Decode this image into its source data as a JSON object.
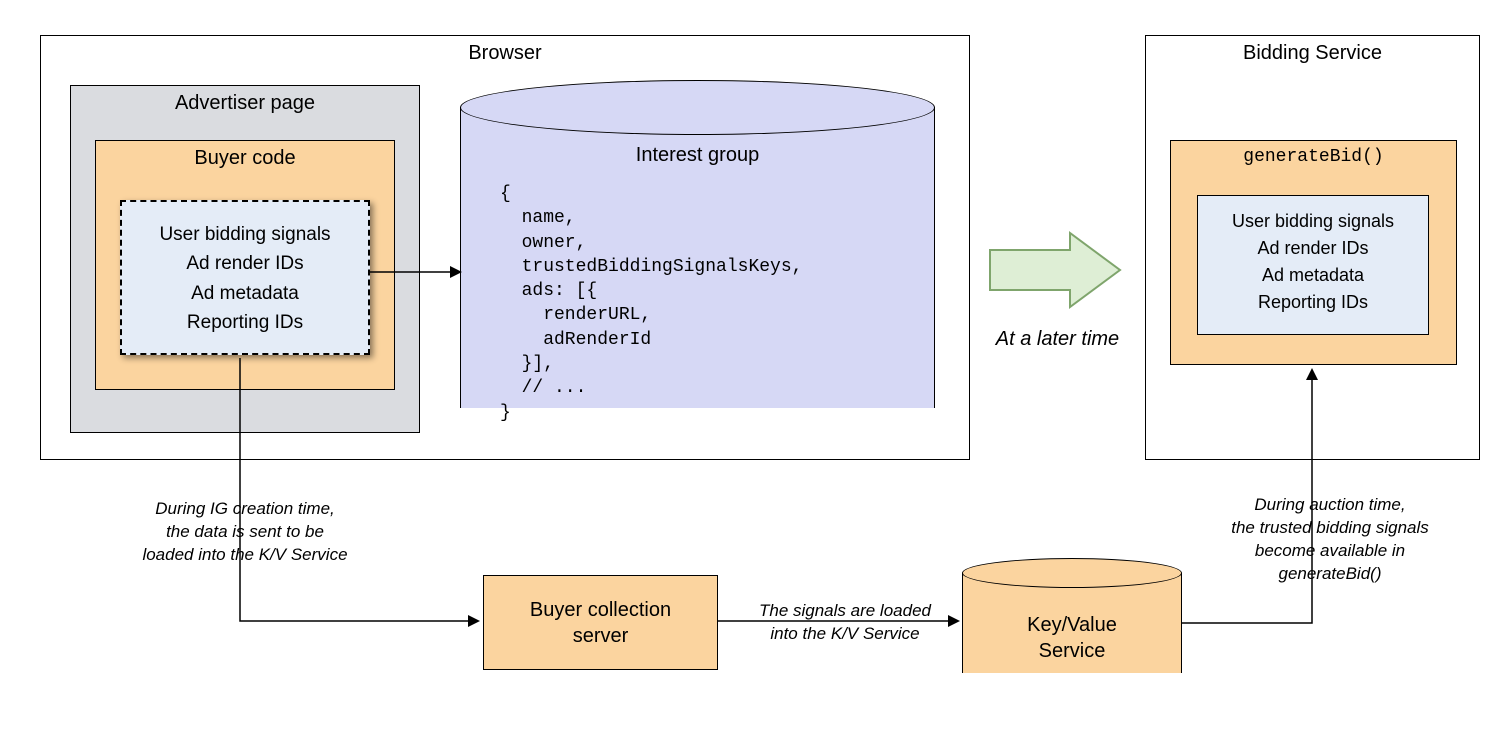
{
  "browser": {
    "title": "Browser",
    "advertiser_page": {
      "title": "Advertiser page",
      "buyer_code": {
        "title": "Buyer code",
        "signals": {
          "line1": "User bidding signals",
          "line2": "Ad render IDs",
          "line3": "Ad metadata",
          "line4": "Reporting IDs"
        }
      }
    },
    "interest_group": {
      "title": "Interest group",
      "code": "{\n  name,\n  owner,\n  trustedBiddingSignalsKeys,\n  ads: [{\n    renderURL,\n    adRenderId\n  }],\n  // ...\n}"
    }
  },
  "big_arrow_label": "At a later time",
  "bidding_service": {
    "title": "Bidding Service",
    "generate_bid": {
      "title": "generateBid()",
      "signals": {
        "line1": "User bidding signals",
        "line2": "Ad render IDs",
        "line3": "Ad metadata",
        "line4": "Reporting IDs"
      }
    }
  },
  "notes": {
    "ig_creation": "During IG creation time,\nthe data is sent to be\nloaded into the K/V Service",
    "signals_loaded": "The signals are loaded\ninto the K/V Service",
    "auction_time": "During auction time,\nthe trusted bidding signals\nbecome available in\ngenerateBid()"
  },
  "buyer_collection_server": "Buyer collection\nserver",
  "kv_service": "Key/Value\nService"
}
